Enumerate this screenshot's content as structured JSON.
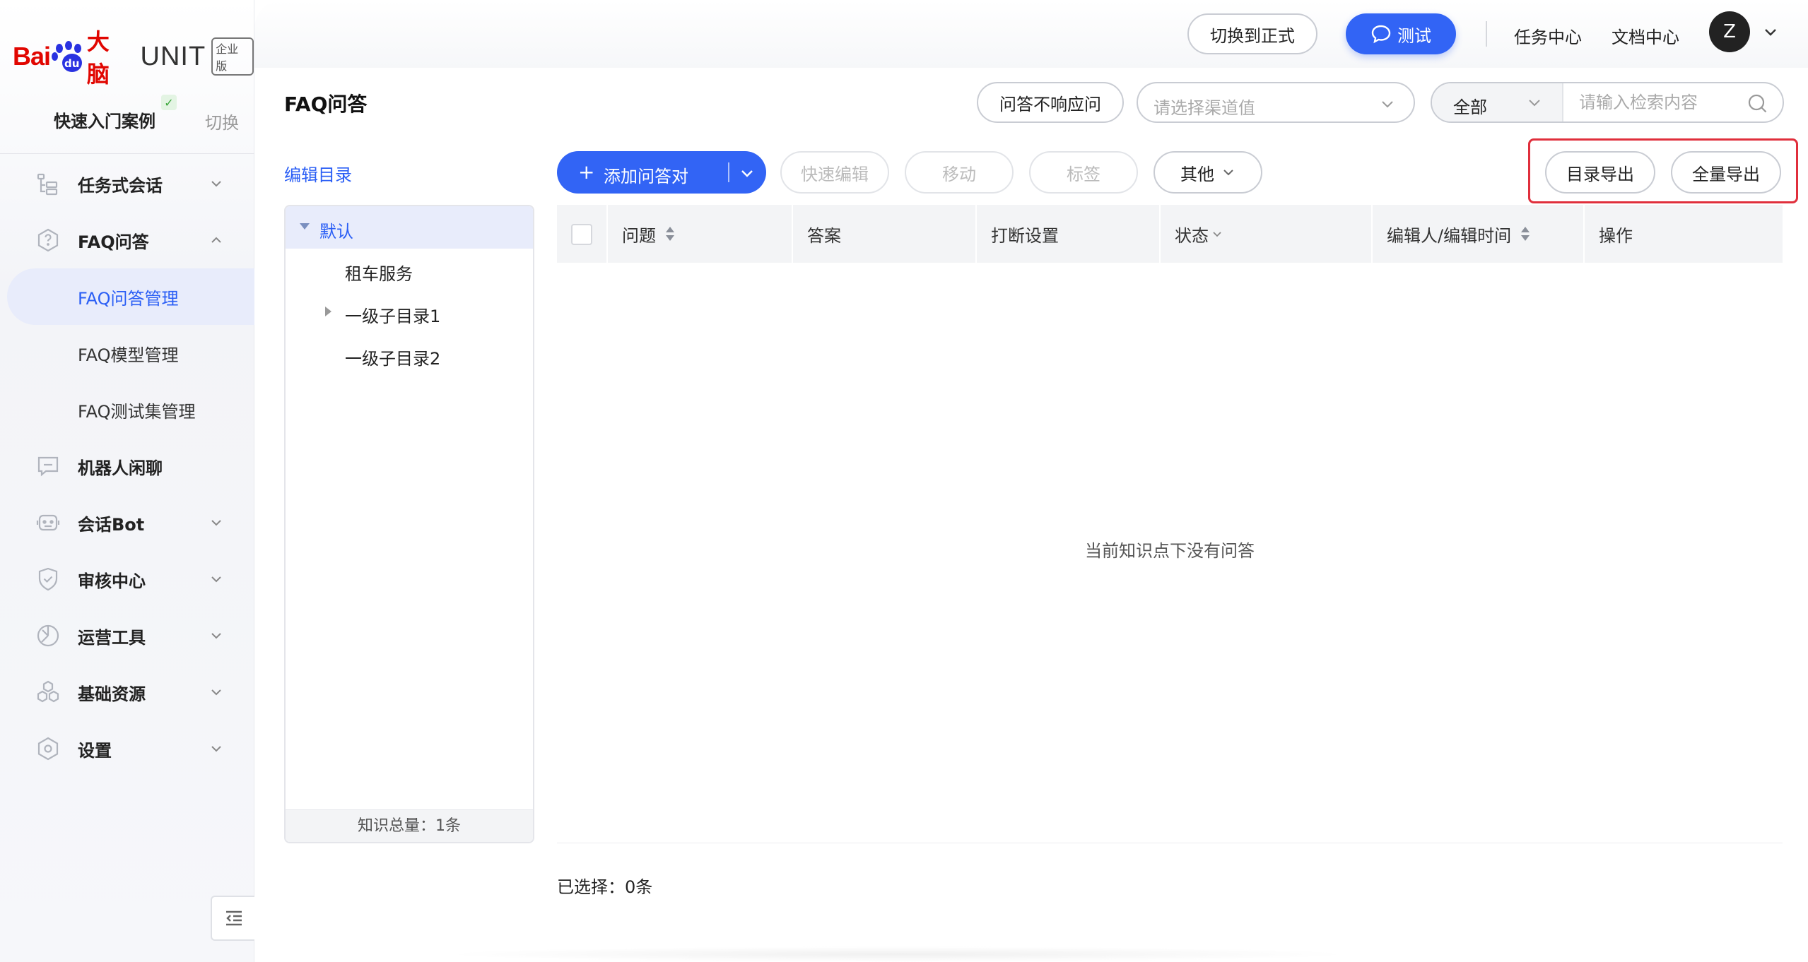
{
  "brand": {
    "bai": "Bai",
    "du": "du",
    "danao": "大脑",
    "unit": "UNIT",
    "edition": "企业版"
  },
  "sidebar": {
    "quick_start": "快速入门案例",
    "switch": "切换",
    "items": [
      {
        "label": "任务式会话",
        "icon": "task-dialog-icon",
        "expanded": false
      },
      {
        "label": "FAQ问答",
        "icon": "faq-icon",
        "expanded": true
      },
      {
        "label": "FAQ问答管理",
        "sub": true,
        "active": true
      },
      {
        "label": "FAQ模型管理",
        "sub": true
      },
      {
        "label": "FAQ测试集管理",
        "sub": true
      },
      {
        "label": "机器人闲聊",
        "icon": "chat-icon"
      },
      {
        "label": "会话Bot",
        "icon": "bot-icon",
        "expanded": false
      },
      {
        "label": "审核中心",
        "icon": "shield-icon",
        "expanded": false
      },
      {
        "label": "运营工具",
        "icon": "ops-tool-icon",
        "expanded": false
      },
      {
        "label": "基础资源",
        "icon": "resource-icon",
        "expanded": false
      },
      {
        "label": "设置",
        "icon": "settings-icon",
        "expanded": false
      }
    ]
  },
  "topbar": {
    "switch_formal": "切换到正式",
    "test": "测试",
    "task_center": "任务中心",
    "doc_center": "文档中心",
    "avatar_letter": "Z"
  },
  "header": {
    "title": "FAQ问答",
    "no_response": "问答不响应问",
    "channel_placeholder": "请选择渠道值",
    "scope_value": "全部",
    "search_placeholder": "请输入检索内容"
  },
  "tree": {
    "edit_dir": "编辑目录",
    "nodes": [
      {
        "label": "默认",
        "level": 0,
        "selected": true,
        "caret": "down"
      },
      {
        "label": "租车服务",
        "level": 1,
        "caret": "none"
      },
      {
        "label": "一级子目录1",
        "level": 1,
        "caret": "right"
      },
      {
        "label": "一级子目录2",
        "level": 1,
        "caret": "none"
      }
    ],
    "footer": "知识总量：1条"
  },
  "toolbar": {
    "add_pair": "添加问答对",
    "quick_edit": "快速编辑",
    "move": "移动",
    "tag": "标签",
    "other": "其他",
    "export_dir": "目录导出",
    "export_all": "全量导出"
  },
  "table": {
    "columns": [
      {
        "label": "问题",
        "sort": "both"
      },
      {
        "label": "答案"
      },
      {
        "label": "打断设置"
      },
      {
        "label": "状态",
        "sort": "down"
      },
      {
        "label": "编辑人/编辑时间",
        "sort": "both"
      },
      {
        "label": "操作"
      }
    ],
    "rows": [],
    "empty": "当前知识点下没有问答"
  },
  "footer": {
    "selected": "已选择：0条"
  },
  "colors": {
    "primary": "#3264f5",
    "highlight_box": "#e02f3c",
    "brand_red": "#e10601",
    "brand_blue": "#2932e1"
  }
}
